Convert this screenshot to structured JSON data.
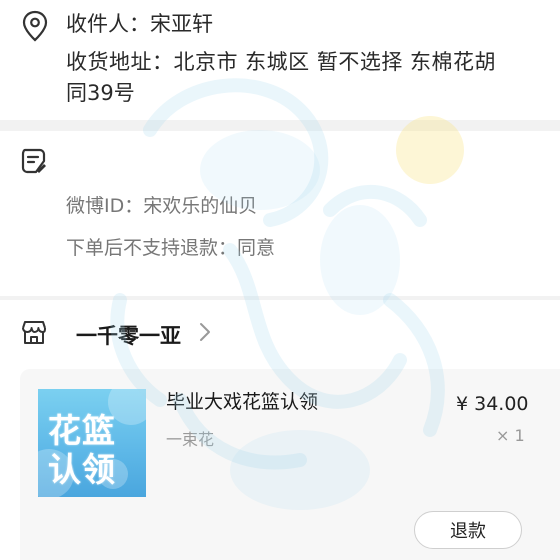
{
  "address": {
    "receiver": "收件人：宋亚轩",
    "line1": "收货地址：北京市 东城区 暂不选择  东棉花胡",
    "line2": "同39号"
  },
  "notes": {
    "weibo": "微博ID：宋欢乐的仙贝",
    "refund_policy": "下单后不支持退款：同意"
  },
  "store": {
    "name": "一千零一亚"
  },
  "product": {
    "thumb_line1": "花篮",
    "thumb_line2": "认领",
    "title": "毕业大戏花篮认领",
    "spec": "一束花",
    "price": "¥ 34.00",
    "quantity": "× 1"
  },
  "actions": {
    "refund_label": "退款"
  },
  "icons": {
    "location": "location-pin-icon",
    "note": "note-edit-icon",
    "store": "store-icon",
    "chevron": "chevron-right-icon"
  },
  "colors": {
    "background": "#f2f2f2",
    "card": "#ffffff",
    "thumb_blue": "#5fb9e8"
  }
}
